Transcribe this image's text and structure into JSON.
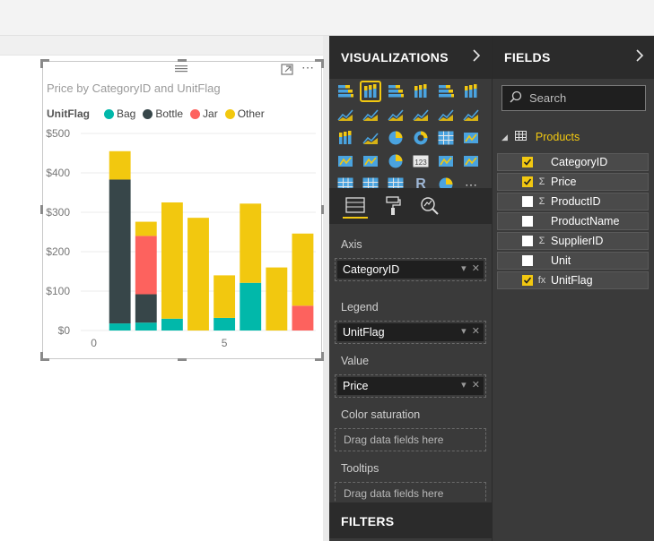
{
  "colors": {
    "bag": "#01b8aa",
    "bottle": "#374649",
    "jar": "#fd625e",
    "other": "#f2c80f",
    "accent": "#f2c811",
    "pane_bg": "#3a3a3a",
    "pane_header": "#2b2b2b"
  },
  "visual": {
    "title": "Price by CategoryID and UnitFlag",
    "legend_title": "UnitFlag",
    "legend_items": [
      {
        "label": "Bag",
        "color": "#01b8aa"
      },
      {
        "label": "Bottle",
        "color": "#374649"
      },
      {
        "label": "Jar",
        "color": "#fd625e"
      },
      {
        "label": "Other",
        "color": "#f2c80f"
      }
    ],
    "focus_mode_icon": "focus-mode-icon",
    "more_options_icon": "more-options-icon",
    "drag_grip_icon": "drag-grip-icon"
  },
  "chart_data": {
    "type": "bar",
    "stacked": true,
    "title": "Price by CategoryID and UnitFlag",
    "xlabel": "",
    "ylabel": "",
    "x": [
      1,
      2,
      3,
      4,
      5,
      6,
      7,
      8
    ],
    "x_ticks": [
      "0",
      "5"
    ],
    "y_ticks": [
      "$0",
      "$100",
      "$200",
      "$300",
      "$400",
      "$500"
    ],
    "xlim": [
      -0.5,
      8.5
    ],
    "ylim": [
      0,
      500
    ],
    "legend": "top-left",
    "grid": true,
    "series": [
      {
        "name": "Bag",
        "values": [
          18,
          20,
          30,
          0,
          32,
          121,
          0,
          0
        ]
      },
      {
        "name": "Bottle",
        "values": [
          365,
          72,
          0,
          0,
          0,
          0,
          0,
          0
        ]
      },
      {
        "name": "Jar",
        "values": [
          0,
          148,
          0,
          0,
          0,
          0,
          0,
          63
        ]
      },
      {
        "name": "Other",
        "values": [
          72,
          36,
          295,
          286,
          108,
          201,
          160,
          183
        ]
      }
    ]
  },
  "visualizations": {
    "title": "VISUALIZATIONS",
    "chevron": "chevron-right-icon",
    "icons": [
      "stacked-bar-chart-icon",
      "stacked-column-chart-icon",
      "clustered-bar-chart-icon",
      "clustered-column-chart-icon",
      "100-stacked-bar-chart-icon",
      "100-stacked-column-chart-icon",
      "line-chart-icon",
      "area-chart-icon",
      "stacked-area-chart-icon",
      "line-clustered-column-icon",
      "line-stacked-column-icon",
      "ribbon-chart-icon",
      "waterfall-chart-icon",
      "scatter-chart-icon",
      "pie-chart-icon",
      "donut-chart-icon",
      "treemap-icon",
      "map-icon",
      "filled-map-icon",
      "funnel-icon",
      "gauge-icon",
      "card-icon",
      "multi-row-card-icon",
      "kpi-icon",
      "slicer-icon",
      "table-icon",
      "matrix-icon",
      "r-visual-icon",
      "globe-icon",
      "more-visuals-icon"
    ],
    "selected_index": 1,
    "tabs": [
      "fields-tab-icon",
      "format-paint-roller-icon",
      "analytics-magnifier-icon"
    ],
    "wells": {
      "axis_label": "Axis",
      "axis_value": "CategoryID",
      "legend_label": "Legend",
      "legend_value": "UnitFlag",
      "value_label": "Value",
      "value_value": "Price",
      "color_saturation_label": "Color saturation",
      "color_saturation_placeholder": "Drag data fields here",
      "tooltips_label": "Tooltips",
      "tooltips_placeholder": "Drag data fields here"
    },
    "filters_title": "FILTERS"
  },
  "fields": {
    "title": "FIELDS",
    "chevron": "chevron-right-icon",
    "search_placeholder": "Search",
    "table_name": "Products",
    "items": [
      {
        "label": "CategoryID",
        "checked": true,
        "type": ""
      },
      {
        "label": "Price",
        "checked": true,
        "type": "Σ"
      },
      {
        "label": "ProductID",
        "checked": false,
        "type": "Σ"
      },
      {
        "label": "ProductName",
        "checked": false,
        "type": ""
      },
      {
        "label": "SupplierID",
        "checked": false,
        "type": "Σ"
      },
      {
        "label": "Unit",
        "checked": false,
        "type": ""
      },
      {
        "label": "UnitFlag",
        "checked": true,
        "type": "fx"
      }
    ]
  }
}
